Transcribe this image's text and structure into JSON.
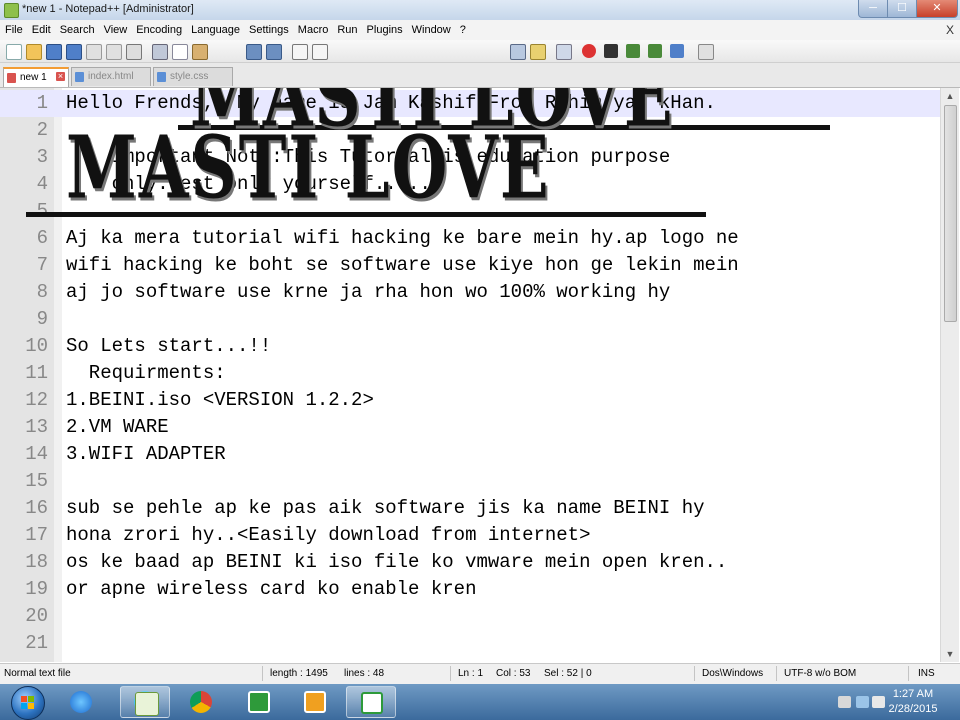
{
  "window": {
    "title": "*new  1 - Notepad++ [Administrator]",
    "min_label": "─",
    "max_label": "☐",
    "close_label": "✕"
  },
  "menu": [
    "File",
    "Edit",
    "Search",
    "View",
    "Encoding",
    "Language",
    "Settings",
    "Macro",
    "Run",
    "Plugins",
    "Window",
    "?"
  ],
  "menu_close": "X",
  "toolbar_icons": [
    "new-file-icon",
    "open-file-icon",
    "save-icon",
    "save-all-icon",
    "close-icon",
    "close-all-icon",
    "print-icon",
    "cut-icon",
    "copy-icon",
    "paste-icon",
    "undo-icon",
    "redo-icon",
    "find-icon",
    "replace-icon",
    "zoom-in-icon",
    "zoom-out-icon",
    "sync-scroll-icon",
    "wrap-icon",
    "indent-guide-icon",
    "show-all-icon",
    "macro-record-icon",
    "macro-stop-icon",
    "macro-play-icon",
    "macro-save-icon"
  ],
  "tabs": [
    {
      "label": "new  1",
      "active": true
    },
    {
      "label": "index.html",
      "active": false
    },
    {
      "label": "style.css",
      "active": false
    }
  ],
  "editor": {
    "current_line": 1,
    "lines": [
      {
        "n": "1",
        "text": "Hello Frends,, My name is Jam Kashif From Rahim yar kHan."
      },
      {
        "n": "2",
        "text": ""
      },
      {
        "n": "3",
        "text": "    Important Note:This Tutorial is education purpose"
      },
      {
        "n": "4",
        "text": "    only.Test only yourself.. ..."
      },
      {
        "n": "5",
        "text": ""
      },
      {
        "n": "6",
        "text": "Aj ka mera tutorial wifi hacking ke bare mein hy.ap logo ne"
      },
      {
        "n": "7",
        "text": "wifi hacking ke boht se software use kiye hon ge lekin mein"
      },
      {
        "n": "8",
        "text": "aj jo software use krne ja rha hon wo 100% working hy"
      },
      {
        "n": "9",
        "text": ""
      },
      {
        "n": "10",
        "text": "So Lets start...!!"
      },
      {
        "n": "11",
        "text": "  Requirments:"
      },
      {
        "n": "12",
        "text": "1.BEINI.iso <VERSION 1.2.2>"
      },
      {
        "n": "13",
        "text": "2.VM WARE"
      },
      {
        "n": "14",
        "text": "3.WIFI ADAPTER"
      },
      {
        "n": "15",
        "text": ""
      },
      {
        "n": "16",
        "text": "sub se pehle ap ke pas aik software jis ka name BEINI hy"
      },
      {
        "n": "17",
        "text": "hona zrori hy..<Easily download from internet>"
      },
      {
        "n": "18",
        "text": "os ke baad ap BEINI ki iso file ko vmware mein open kren.."
      },
      {
        "n": "19",
        "text": "or apne wireless card ko enable kren"
      },
      {
        "n": "20",
        "text": ""
      },
      {
        "n": "21",
        "text": ""
      }
    ]
  },
  "watermark": {
    "line1": "MASTI LOVE",
    "line2": "MASTI LOVE"
  },
  "status": {
    "file_type": "Normal text file",
    "length": "length : 1495",
    "lines": "lines : 48",
    "ln": "Ln : 1",
    "col": "Col : 53",
    "sel": "Sel : 52 | 0",
    "eol": "Dos\\Windows",
    "encoding": "UTF-8 w/o BOM",
    "mode": "INS"
  },
  "taskbar": {
    "apps": [
      "ie-icon",
      "skype-icon",
      "notepadpp-icon",
      "chrome-icon",
      "camtasia-icon",
      "outlook-icon",
      "camtasia-recorder-icon"
    ],
    "clock_time": "1:27 AM",
    "clock_date": "2/28/2015"
  },
  "colors": {
    "accent_tab": "#f39c34",
    "current_line": "#e8e8ff",
    "squiggle": "#e04040",
    "taskbar": "#3b6a9c"
  }
}
